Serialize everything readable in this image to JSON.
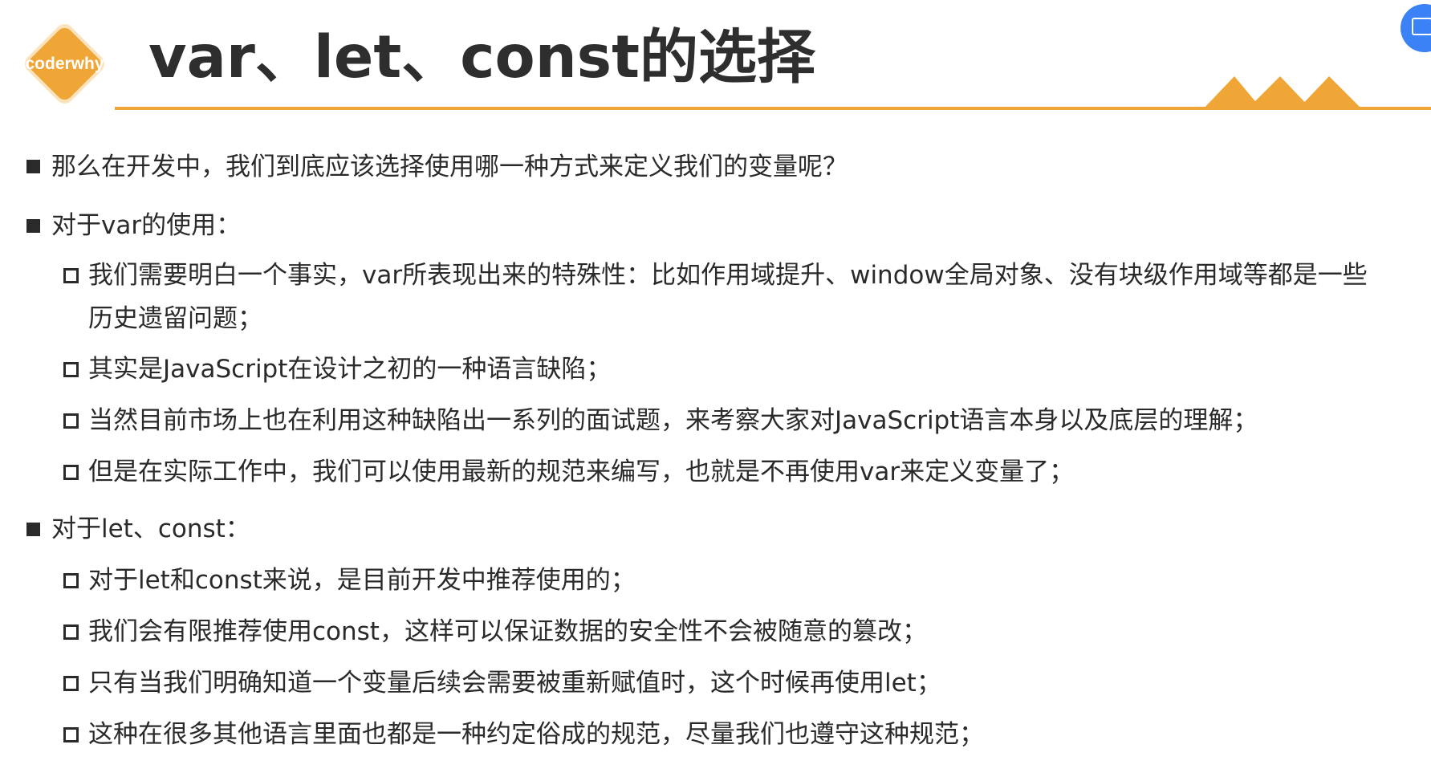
{
  "header": {
    "logo_text": "coderwhy",
    "title": "var、let、const的选择",
    "accent_color": "#f0a636"
  },
  "content": {
    "q_intro": "那么在开发中，我们到底应该选择使用哪一种方式来定义我们的变量呢？",
    "var_heading": "对于var的使用：",
    "var_items": [
      "我们需要明白一个事实，var所表现出来的特殊性：比如作用域提升、window全局对象、没有块级作用域等都是一些",
      "历史遗留问题；",
      "其实是JavaScript在设计之初的一种语言缺陷；",
      "当然目前市场上也在利用这种缺陷出一系列的面试题，来考察大家对JavaScript语言本身以及底层的理解；",
      "但是在实际工作中，我们可以使用最新的规范来编写，也就是不再使用var来定义变量了；"
    ],
    "letconst_heading": "对于let、const：",
    "letconst_items": [
      "对于let和const来说，是目前开发中推荐使用的；",
      "我们会有限推荐使用const，这样可以保证数据的安全性不会被随意的篡改；",
      "只有当我们明确知道一个变量后续会需要被重新赋值时，这个时候再使用let；",
      "这种在很多其他语言里面也都是一种约定俗成的规范，尽量我们也遵守这种规范；"
    ]
  }
}
